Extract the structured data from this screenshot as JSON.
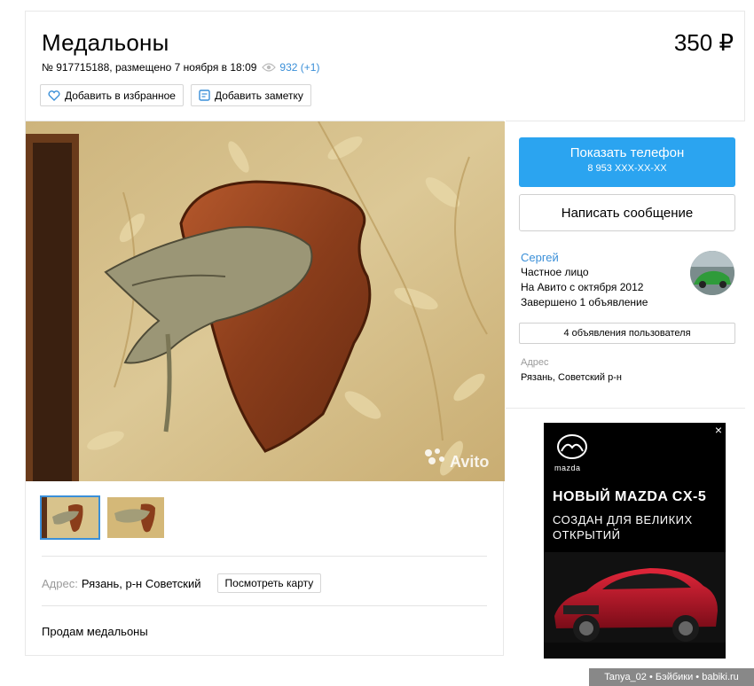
{
  "listing": {
    "title": "Медальоны",
    "price": "350 ₽",
    "meta": "№ 917715188, размещено 7 ноября в 18:09",
    "views": "932 (+1)",
    "favorite_label": "Добавить в избранное",
    "note_label": "Добавить заметку",
    "photo_watermark": "Avito",
    "address_label": "Адрес:",
    "address_value": "Рязань, р-н Советский",
    "map_button": "Посмотреть карту",
    "description": "Продам медальоны"
  },
  "side": {
    "phone_button": "Показать телефон",
    "phone_masked": "8 953 XXX-XX-XX",
    "message_button": "Написать сообщение",
    "seller_name": "Сергей",
    "seller_type": "Частное лицо",
    "seller_since": "На Авито с октября 2012",
    "seller_completed": "Завершено 1 объявление",
    "user_ads_button": "4 объявления пользователя",
    "address_label": "Адрес",
    "address_value": "Рязань, Советский р-н"
  },
  "ad": {
    "close": "×",
    "brand": "mazda",
    "headline": "НОВЫЙ MAZDA CX-5",
    "sub": "СОЗДАН ДЛЯ ВЕЛИКИХ ОТКРЫТИЙ"
  },
  "watermark": "Tanya_02 • Бэйбики • babiki.ru",
  "colors": {
    "accent": "#2ba4f0",
    "link": "#3a8fd8"
  },
  "icons": [
    "heart-icon",
    "note-icon",
    "eye-icon",
    "close-icon",
    "mazda-logo"
  ]
}
